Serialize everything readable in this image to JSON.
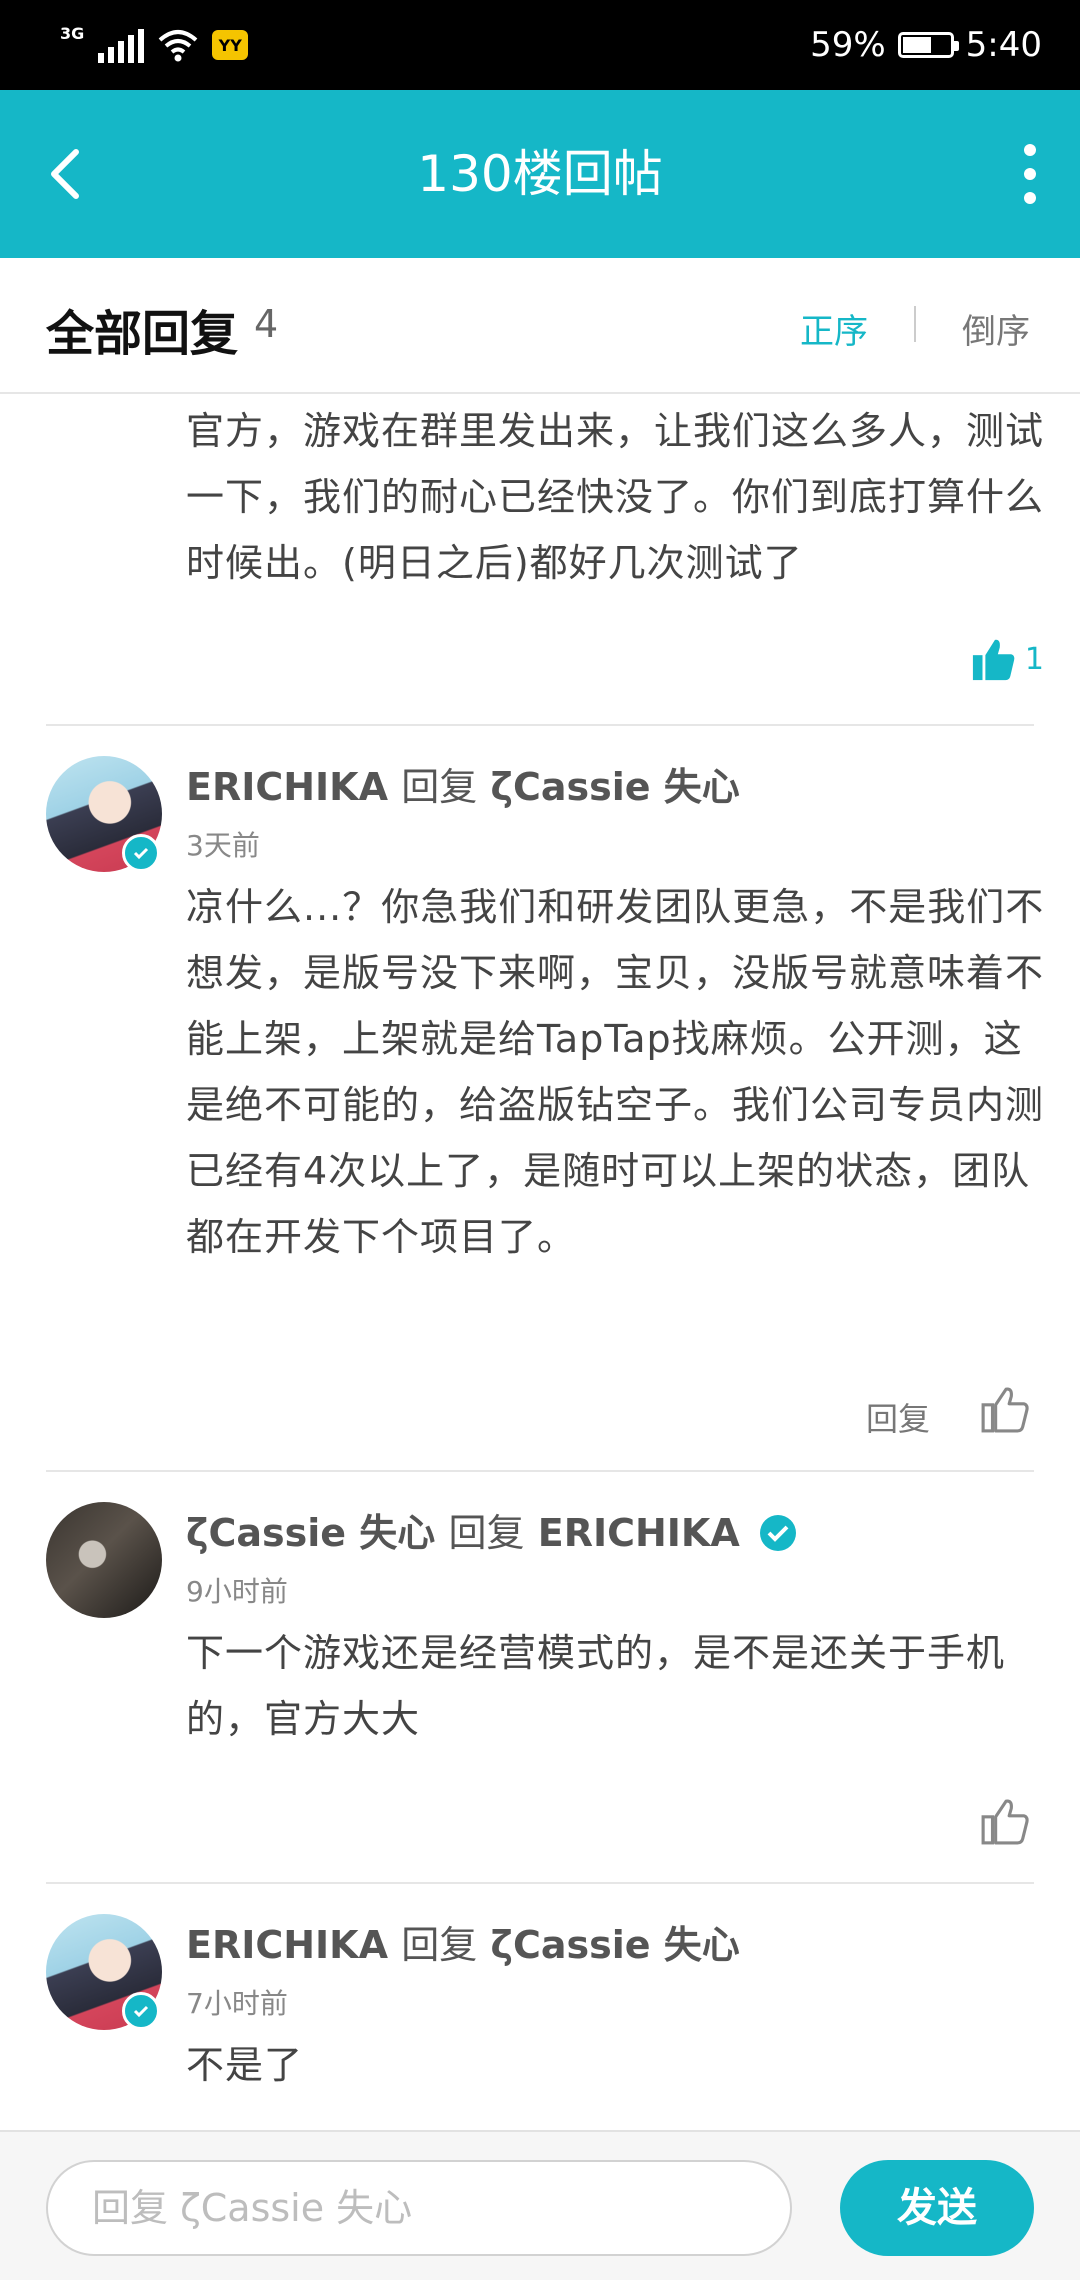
{
  "status_bar": {
    "network": "3G",
    "yy_label": "YY",
    "battery": "59%",
    "time": "5:40"
  },
  "app_bar": {
    "title": "130楼回帖"
  },
  "sort_header": {
    "title": "全部回复",
    "count": "4",
    "asc_label": "正序",
    "desc_label": "倒序"
  },
  "prev_comment": {
    "text": "官方，游戏在群里发出来，让我们这么多人，测试一下，我们的耐心已经快没了。你们到底打算什么时候出。(明日之后)都好几次测试了",
    "likes": "1"
  },
  "comments": [
    {
      "author": "ERICHIKA",
      "verb": "回复",
      "target": "ζCassie 失心",
      "time": "3天前",
      "text": "凉什么...？你急我们和研发团队更急，不是我们不想发，是版号没下来啊，宝贝，没版号就意味着不能上架，上架就是给TapTap找麻烦。公开测，这是绝不可能的，给盗版钻空子。我们公司专员内测已经有4次以上了，是随时可以上架的状态，团队都在开发下个项目了。",
      "reply_label": "回复"
    },
    {
      "author": "ζCassie 失心",
      "verb": "回复",
      "target": "ERICHIKA",
      "time": "9小时前",
      "text": "下一个游戏还是经营模式的，是不是还关于手机的，官方大大"
    },
    {
      "author": "ERICHIKA",
      "verb": "回复",
      "target": "ζCassie 失心",
      "time": "7小时前",
      "text": "不是了"
    }
  ],
  "bottom_bar": {
    "placeholder": "回复 ζCassie 失心",
    "send_label": "发送"
  },
  "colors": {
    "accent": "#15b7c7",
    "status_bar": "#000000"
  }
}
